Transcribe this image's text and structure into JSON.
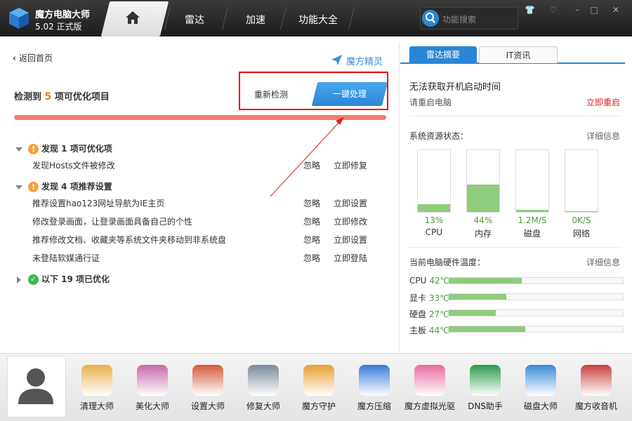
{
  "app": {
    "name": "魔方电脑大师",
    "version": "5.02 正式版"
  },
  "nav": {
    "items": [
      "雷达",
      "加速",
      "功能大全"
    ]
  },
  "search": {
    "placeholder": "功能搜索"
  },
  "left": {
    "back": "返回首页",
    "spirit": "魔方精灵",
    "detect": {
      "prefix": "检测到",
      "count": "5",
      "suffix": "项可优化项目"
    },
    "recheck": "重新检测",
    "onekey": "一键处理",
    "groups": [
      {
        "title": "发现 1 项可优化项",
        "items": [
          {
            "text": "发现Hosts文件被修改",
            "ignore": "忽略",
            "action": "立即修复"
          }
        ]
      },
      {
        "title": "发现 4 项推荐设置",
        "items": [
          {
            "text": "推荐设置hao123网址导航为IE主页",
            "ignore": "忽略",
            "action": "立即设置"
          },
          {
            "text": "修改登录画面，让登录画面具备自己的个性",
            "ignore": "忽略",
            "action": "立即修改"
          },
          {
            "text": "推荐修改文档、收藏夹等系统文件夹移动到非系统盘",
            "ignore": "忽略",
            "action": "立即设置"
          },
          {
            "text": "未登陆软媒通行证",
            "ignore": "忽略",
            "action": "立即登陆"
          }
        ]
      },
      {
        "title": "以下 19 项已优化"
      }
    ]
  },
  "right": {
    "tabs": [
      "雷达摘要",
      "IT资讯"
    ],
    "boot_title": "无法获取开机启动时间",
    "boot_sub": "请重启电脑",
    "restart": "立即重启",
    "res_title": "系统资源状态：",
    "details": "详细信息",
    "resources": [
      {
        "label": "CPU",
        "value": "13%",
        "level": 0.13
      },
      {
        "label": "内存",
        "value": "44%",
        "level": 0.44
      },
      {
        "label": "磁盘",
        "value": "1.2M/S",
        "level": 0.03
      },
      {
        "label": "网络",
        "value": "0K/S",
        "level": 0.0
      }
    ],
    "temp_title": "当前电脑硬件温度：",
    "temps": [
      {
        "label": "CPU",
        "value": "42℃",
        "level": 0.42
      },
      {
        "label": "显卡",
        "value": "33℃",
        "level": 0.33
      },
      {
        "label": "硬盘",
        "value": "27℃",
        "level": 0.27
      },
      {
        "label": "主板",
        "value": "44℃",
        "level": 0.44
      }
    ]
  },
  "dock": {
    "items": [
      {
        "label": "清理大师",
        "color": "#e8b04a"
      },
      {
        "label": "美化大师",
        "color": "#c46aa8"
      },
      {
        "label": "设置大师",
        "color": "#d85a3a"
      },
      {
        "label": "修复大师",
        "color": "#7a8a9a"
      },
      {
        "label": "魔方守护",
        "color": "#e8a030"
      },
      {
        "label": "魔方压缩",
        "color": "#3a7ad8"
      },
      {
        "label": "魔方虚拟光驱",
        "color": "#e86aa0"
      },
      {
        "label": "DNS助手",
        "color": "#2a9a4a"
      },
      {
        "label": "磁盘大师",
        "color": "#3a8ad8"
      },
      {
        "label": "魔方收音机",
        "color": "#c84040"
      }
    ]
  },
  "colors": {
    "accent": "#2a86d6",
    "warn": "#f5a23c",
    "progress": "#f47c6c",
    "good": "#8fcc7c",
    "alert": "#e02020"
  },
  "icons": [
    "cube-logo-icon",
    "home-icon",
    "search-icon",
    "shirt-icon",
    "heart-icon",
    "minimize-icon",
    "maximize-icon",
    "close-icon",
    "spirit-arrow-icon",
    "avatar-icon"
  ]
}
